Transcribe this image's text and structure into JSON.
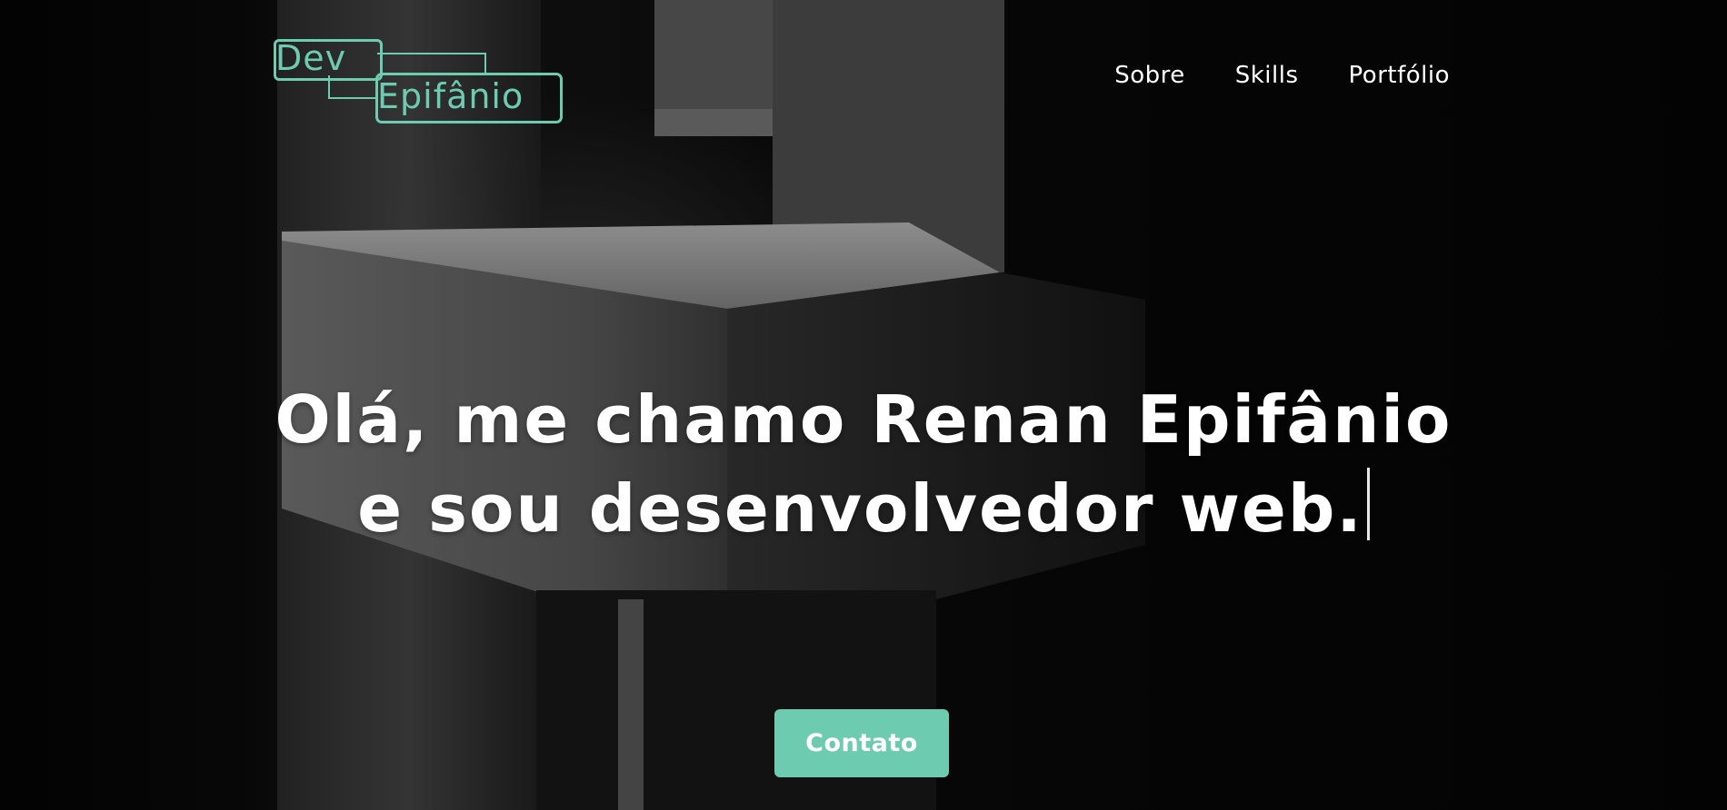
{
  "colors": {
    "accent": "#6dcbb0",
    "text": "#ffffff",
    "background": "#070707"
  },
  "logo": {
    "line1": "Dev",
    "line2": "Epifânio"
  },
  "nav": {
    "items": [
      {
        "label": "Sobre"
      },
      {
        "label": "Skills"
      },
      {
        "label": "Portfólio"
      }
    ]
  },
  "hero": {
    "line1": "Olá, me chamo Renan Epifânio",
    "line2": "e sou desenvolvedor web.",
    "cta_label": "Contato"
  }
}
